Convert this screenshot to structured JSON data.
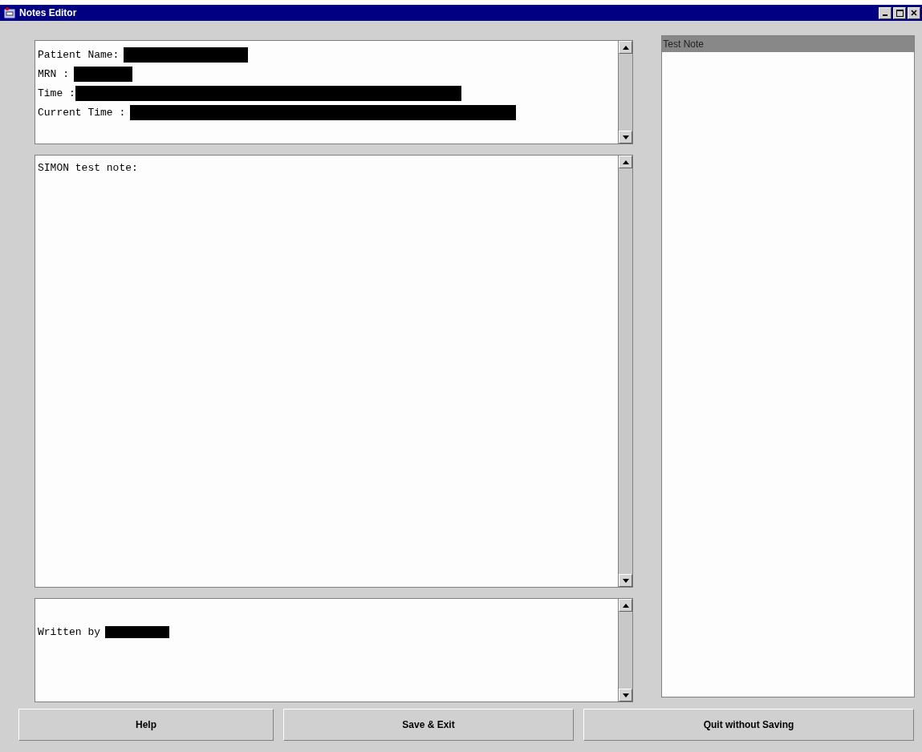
{
  "window": {
    "title": "Notes Editor"
  },
  "header_panel": {
    "lines": [
      {
        "label": "Patient Name:",
        "redacted": true
      },
      {
        "label": "MRN :",
        "redacted": true
      },
      {
        "label": "Time :",
        "redacted": true
      },
      {
        "label": "Current Time :",
        "redacted": true
      }
    ]
  },
  "note_panel": {
    "text": "SIMON test note:"
  },
  "signature_panel": {
    "label": "Written by",
    "redacted": true
  },
  "notes_list": {
    "items": [
      {
        "label": "Test Note",
        "selected": true
      }
    ]
  },
  "buttons": [
    "Help",
    "Save & Exit",
    "Quit without Saving"
  ]
}
